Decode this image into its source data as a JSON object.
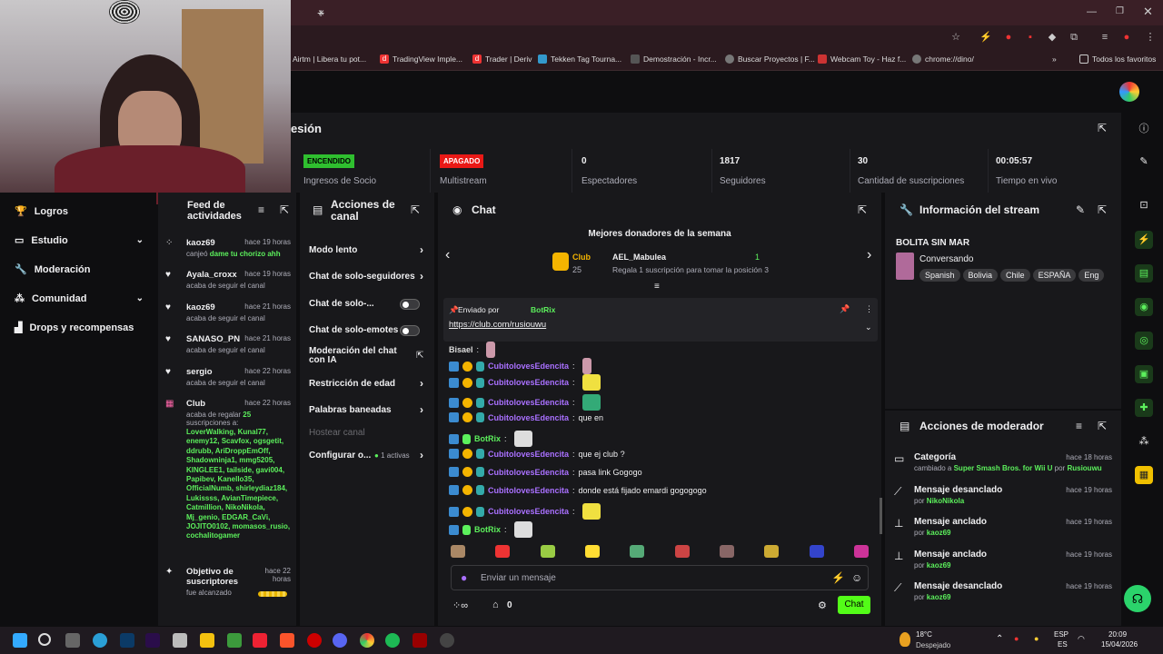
{
  "browser": {
    "tab_close": "×",
    "tab_new": "+",
    "bookmarks": [
      "Airtm | Libera tu pot...",
      "TradingView Imple...",
      "Trader | Deriv",
      "Tekken Tag Tourna...",
      "Demostración - Incr...",
      "Buscar Proyectos | F...",
      "Webcam Toy - Haz f...",
      "chrome://dino/"
    ],
    "all_bookmarks": "Todos los favoritos"
  },
  "stats": {
    "header": "esión",
    "ingresos_badge": "ENCENDIDO",
    "ingresos_label": "Ingresos de Socio",
    "multistream_badge": "APAGADO",
    "multistream_label": "Multistream",
    "espectadores_value": "0",
    "espectadores_label": "Espectadores",
    "seguidores_value": "1817",
    "seguidores_label": "Seguidores",
    "suscripciones_value": "30",
    "suscripciones_label": "Cantidad de suscripciones",
    "tiempo_value": "00:05:57",
    "tiempo_label": "Tiempo en vivo"
  },
  "nav": {
    "items": [
      {
        "label": "Logros"
      },
      {
        "label": "Estudio"
      },
      {
        "label": "Moderación"
      },
      {
        "label": "Comunidad"
      },
      {
        "label": "Drops y recompensas"
      }
    ]
  },
  "feed": {
    "title": "Feed de actividades",
    "items": [
      {
        "name": "kaoz69",
        "time": "hace 19 horas",
        "detail_pre": "canjeó ",
        "detail_hl": "dame tu chorizo ahh"
      },
      {
        "name": "Ayala_croxx",
        "time": "hace 19 horas",
        "detail": "acaba de seguir el canal"
      },
      {
        "name": "kaoz69",
        "time": "hace 21 horas",
        "detail": "acaba de seguir el canal"
      },
      {
        "name": "SANASO_PN",
        "time": "hace 21 horas",
        "detail": "acaba de seguir el canal"
      },
      {
        "name": "sergio",
        "time": "hace 22 horas",
        "detail": "acaba de seguir el canal"
      },
      {
        "name": "Club",
        "time": "hace 22 horas",
        "detail_pre": "acaba de regalar ",
        "detail_hl": "25",
        "detail_post": " suscripciones a:",
        "gift_list": "LoverWalking, Kunal77, enemy12, Scavfox, ogsgetit, ddrubb, AriDroppEmOff, Shadowninja1, mmg5205, KINGLEE1, tailside, gavi004, Papibev, Kanello35, OfficialNumb, shirleydiaz184, Lukissss, AvianTimepiece, Catmillion, NikoNikola, Mj_genio, EDGAR_CaVi, JOJITO0102, momasos_rusio, cochalitogamer"
      },
      {
        "name": "Objetivo de suscriptores",
        "time": "hace 22 horas",
        "detail": "fue alcanzado"
      }
    ]
  },
  "acciones": {
    "title": "Acciones de canal",
    "items": [
      "Modo lento",
      "Chat de solo-seguidores",
      "Chat de solo-...",
      "Chat de solo-emotes",
      "Moderación del chat con IA",
      "Restricción de edad",
      "Palabras baneadas",
      "Hostear canal",
      "Configurar o..."
    ],
    "configurar_badge": "1 activas"
  },
  "chat": {
    "title": "Chat",
    "donors_title": "Mejores donadores de la semana",
    "donor1_name": "Club",
    "donor1_count": "25",
    "donor2_name": "AEL_Mabulea",
    "donor2_count": "1",
    "donor2_text": "Regala 1 suscripción para tomar la posición 3",
    "pinned_by_label": "Enviado por",
    "pinned_by_user": "BotRix",
    "pinned_link": "https://club.com/rusiouwu",
    "messages": [
      {
        "user": "Bisael",
        "text": ""
      },
      {
        "user": "CubitolovesEdencita",
        "text": ""
      },
      {
        "user": "CubitolovesEdencita",
        "text": ""
      },
      {
        "user": "CubitolovesEdencita",
        "text": ""
      },
      {
        "user": "CubitolovesEdencita",
        "text": "que en"
      },
      {
        "user": "BotRix",
        "text": ""
      },
      {
        "user": "CubitolovesEdencita",
        "text": "que ej club ?"
      },
      {
        "user": "CubitolovesEdencita",
        "text": "pasa link Gogogo"
      },
      {
        "user": "CubitolovesEdencita",
        "text": "donde está fijado emardi gogogogo"
      },
      {
        "user": "CubitolovesEdencita",
        "text": ""
      },
      {
        "user": "BotRix",
        "text": ""
      }
    ],
    "input_placeholder": "Enviar un mensaje",
    "points": "0",
    "send_label": "Chat"
  },
  "info": {
    "title": "Información del stream",
    "stream_title": "BOLITA SIN MAR",
    "category": "Conversando",
    "tags": [
      "Spanish",
      "Bolivia",
      "Chile",
      "ESPAÑA",
      "Eng"
    ]
  },
  "modact": {
    "title": "Acciones de moderador",
    "items": [
      {
        "name": "Categoría",
        "time": "hace 18 horas",
        "pre": "cambiado a ",
        "hl": "Super Smash Bros. for Wii U",
        "mid": " por ",
        "hl2": "Rusiouwu"
      },
      {
        "name": "Mensaje desanclado",
        "time": "hace 19 horas",
        "pre": "por ",
        "hl": "NikoNikola"
      },
      {
        "name": "Mensaje anclado",
        "time": "hace 19 horas",
        "pre": "por ",
        "hl": "kaoz69"
      },
      {
        "name": "Mensaje anclado",
        "time": "hace 19 horas",
        "pre": "por ",
        "hl": "kaoz69"
      },
      {
        "name": "Mensaje desanclado",
        "time": "hace 19 horas",
        "pre": "por ",
        "hl": "kaoz69"
      }
    ]
  },
  "taskbar": {
    "weather_temp": "18°C",
    "weather_text": "Despejado",
    "lang1": "ESP",
    "lang2": "ES",
    "time": "20:09",
    "date": "15/04/2026"
  }
}
